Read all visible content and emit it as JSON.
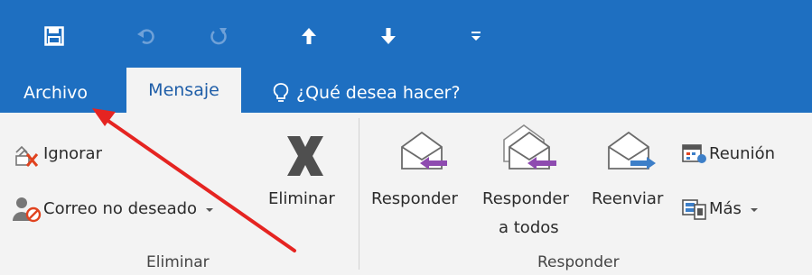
{
  "qat": {
    "icons": [
      "save-icon",
      "undo-icon",
      "redo-icon",
      "up-arrow-icon",
      "down-arrow-icon",
      "customize-icon"
    ]
  },
  "tabs": {
    "archivo": "Archivo",
    "mensaje": "Mensaje",
    "tell_me": "¿Qué desea hacer?"
  },
  "ribbon": {
    "eliminar_group": {
      "ignorar": "Ignorar",
      "correo_no_deseado": "Correo no deseado",
      "eliminar": "Eliminar",
      "label": "Eliminar"
    },
    "responder_group": {
      "responder": "Responder",
      "responder_a_todos_line1": "Responder",
      "responder_a_todos_line2": "a todos",
      "reenviar": "Reenviar",
      "reunion": "Reunión",
      "mas": "Más",
      "label": "Responder"
    }
  },
  "colors": {
    "title_bar": "#1e6fc1",
    "ribbon_bg": "#f3f3f3",
    "annotation_arrow": "#e52421"
  }
}
